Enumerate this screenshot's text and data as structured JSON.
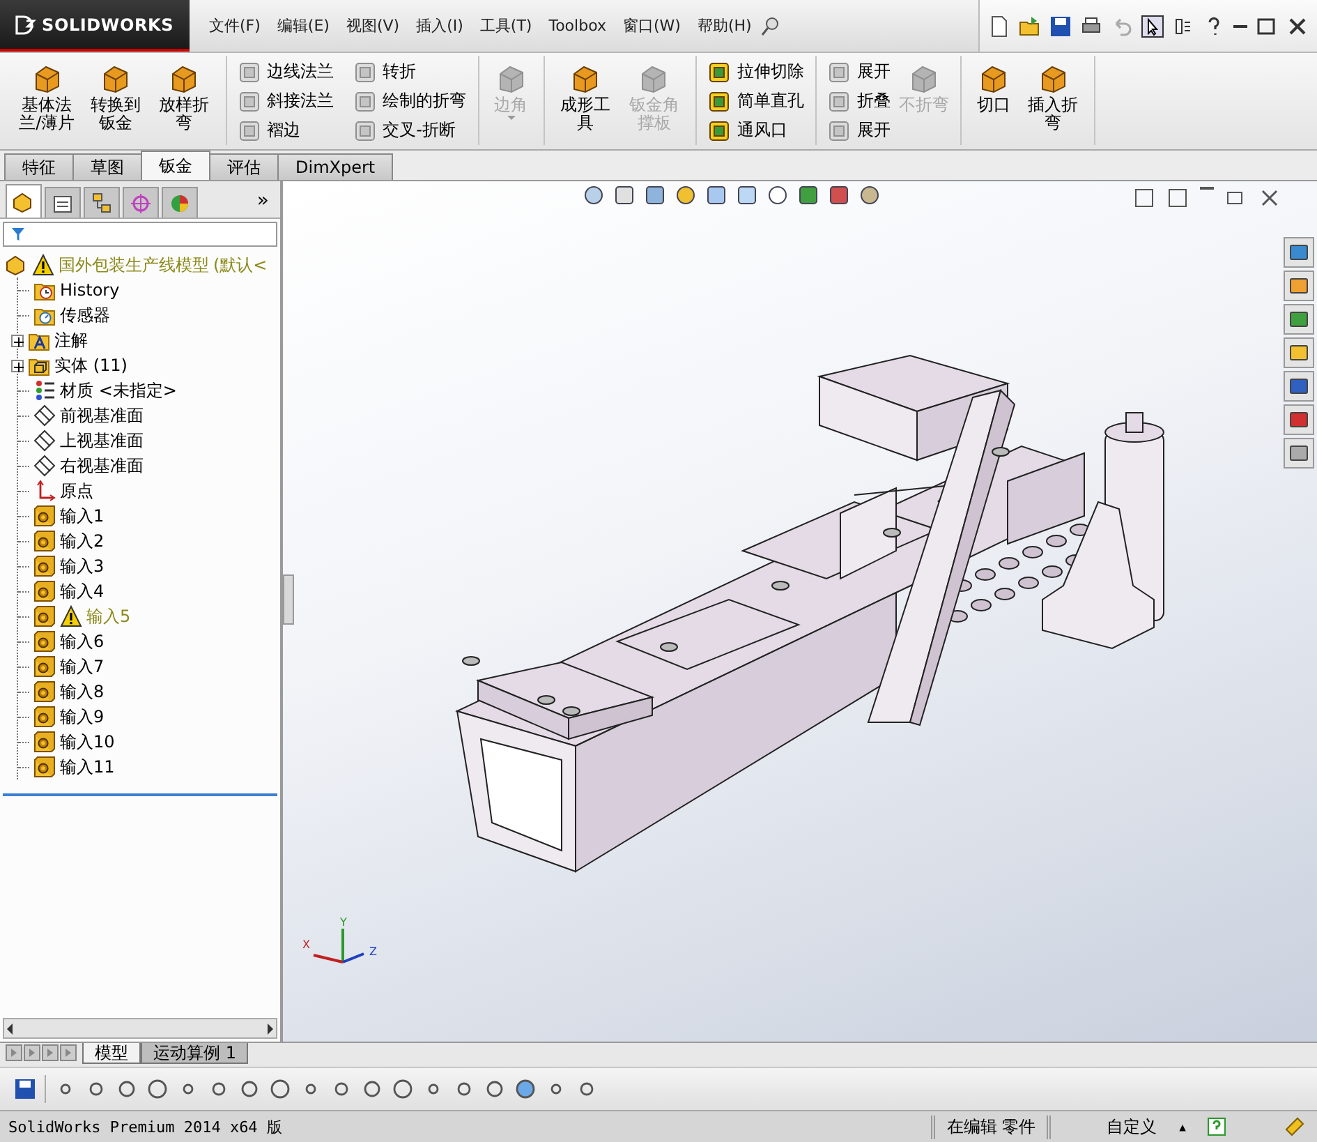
{
  "app": {
    "logo": "SOLIDWORKS"
  },
  "menus": [
    "文件(F)",
    "编辑(E)",
    "视图(V)",
    "插入(I)",
    "工具(T)",
    "Toolbox",
    "窗口(W)",
    "帮助(H)"
  ],
  "ribbon": {
    "groups": [
      {
        "items": [
          {
            "label": "基体法兰/薄片",
            "kind": "large",
            "disabled": false
          },
          {
            "label": "转换到钣金",
            "kind": "large",
            "disabled": false
          },
          {
            "label": "放样折弯",
            "kind": "large",
            "disabled": false
          }
        ]
      },
      {
        "items": [
          {
            "label": "边线法兰",
            "kind": "small",
            "disabled": true
          },
          {
            "label": "斜接法兰",
            "kind": "small",
            "disabled": true
          },
          {
            "label": "褶边",
            "kind": "small",
            "disabled": true
          },
          {
            "label": "转折",
            "kind": "small",
            "disabled": true
          },
          {
            "label": "绘制的折弯",
            "kind": "small",
            "disabled": true
          },
          {
            "label": "交叉-折断",
            "kind": "small",
            "disabled": true
          }
        ]
      },
      {
        "items": [
          {
            "label": "边角",
            "kind": "large",
            "disabled": true,
            "dropdown": true
          }
        ]
      },
      {
        "items": [
          {
            "label": "成形工具",
            "kind": "large",
            "disabled": false
          },
          {
            "label": "钣金角撑板",
            "kind": "large",
            "disabled": true
          }
        ]
      },
      {
        "items": [
          {
            "label": "拉伸切除",
            "kind": "small",
            "disabled": false
          },
          {
            "label": "简单直孔",
            "kind": "small",
            "disabled": false
          },
          {
            "label": "通风口",
            "kind": "small",
            "disabled": false
          }
        ]
      },
      {
        "items": [
          {
            "label": "展开",
            "kind": "small",
            "disabled": true
          },
          {
            "label": "折叠",
            "kind": "small",
            "disabled": true
          },
          {
            "label": "展开",
            "kind": "small",
            "disabled": true
          },
          {
            "label": "不折弯",
            "kind": "large",
            "disabled": true
          }
        ]
      },
      {
        "items": [
          {
            "label": "切口",
            "kind": "large",
            "disabled": false
          },
          {
            "label": "插入折弯",
            "kind": "large",
            "disabled": false
          }
        ]
      }
    ]
  },
  "command_tabs": [
    {
      "label": "特征",
      "selected": false
    },
    {
      "label": "草图",
      "selected": false
    },
    {
      "label": "钣金",
      "selected": true
    },
    {
      "label": "评估",
      "selected": false
    },
    {
      "label": "DimXpert",
      "selected": false
    }
  ],
  "panel_tabs": [
    {
      "selected": true
    },
    {
      "selected": false
    },
    {
      "selected": false
    },
    {
      "selected": false
    },
    {
      "selected": false
    }
  ],
  "panel_more": "»",
  "feature_tree": {
    "label": "国外包装生产线模型",
    "config": "(默认<",
    "warning": true,
    "children": [
      {
        "label": "History",
        "kind": "history",
        "expandable": false,
        "warning": false
      },
      {
        "label": "传感器",
        "kind": "sensors",
        "expandable": false,
        "warning": false
      },
      {
        "label": "注解",
        "kind": "annotations",
        "expandable": true,
        "warning": false
      },
      {
        "label": "实体 (11)",
        "kind": "bodies",
        "expandable": true,
        "warning": false
      },
      {
        "label": "材质 <未指定>",
        "kind": "material",
        "expandable": false,
        "warning": false
      },
      {
        "label": "前视基准面",
        "kind": "plane",
        "expandable": false,
        "warning": false
      },
      {
        "label": "上视基准面",
        "kind": "plane",
        "expandable": false,
        "warning": false
      },
      {
        "label": "右视基准面",
        "kind": "plane",
        "expandable": false,
        "warning": false
      },
      {
        "label": "原点",
        "kind": "origin",
        "expandable": false,
        "warning": false
      },
      {
        "label": "输入1",
        "kind": "import",
        "expandable": false,
        "warning": false
      },
      {
        "label": "输入2",
        "kind": "import",
        "expandable": false,
        "warning": false
      },
      {
        "label": "输入3",
        "kind": "import",
        "expandable": false,
        "warning": false
      },
      {
        "label": "输入4",
        "kind": "import",
        "expandable": false,
        "warning": false
      },
      {
        "label": "输入5",
        "kind": "import",
        "expandable": false,
        "warning": true
      },
      {
        "label": "输入6",
        "kind": "import",
        "expandable": false,
        "warning": false
      },
      {
        "label": "输入7",
        "kind": "import",
        "expandable": false,
        "warning": false
      },
      {
        "label": "输入8",
        "kind": "import",
        "expandable": false,
        "warning": false
      },
      {
        "label": "输入9",
        "kind": "import",
        "expandable": false,
        "warning": false
      },
      {
        "label": "输入10",
        "kind": "import",
        "expandable": false,
        "warning": false
      },
      {
        "label": "输入11",
        "kind": "import",
        "expandable": false,
        "warning": false
      }
    ]
  },
  "triad": {
    "x": "X",
    "y": "Y",
    "z": "Z"
  },
  "bottom_tabs": [
    {
      "label": "模型",
      "selected": true
    },
    {
      "label": "运动算例 1",
      "selected": false
    }
  ],
  "status_bar": {
    "product": "SolidWorks Premium 2014 x64 版",
    "mode": "在编辑 零件",
    "units": "自定义",
    "arrow": "▲"
  }
}
